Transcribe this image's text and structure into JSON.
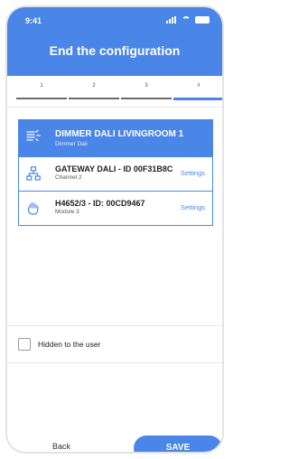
{
  "status_bar": {
    "time": "9:41"
  },
  "header": {
    "title": "End the configuration"
  },
  "steps": [
    {
      "label": "1",
      "active": false
    },
    {
      "label": "2",
      "active": false
    },
    {
      "label": "3",
      "active": false
    },
    {
      "label": "4",
      "active": true
    }
  ],
  "devices": [
    {
      "title": "DIMMER DALI LIVINGROOM 1",
      "subtitle": "Dimmer Dali",
      "icon": "dimmer-icon"
    },
    {
      "title": "GATEWAY DALI - ID 00F31B8C",
      "subtitle": "Channel 2",
      "icon": "network-icon",
      "action": "Settings"
    },
    {
      "title": "H4652/3 - ID: 00CD9467",
      "subtitle": "Module 3",
      "icon": "hand-touch-icon",
      "action": "Settings"
    }
  ],
  "hidden_option": {
    "label": "Hidden to the user",
    "checked": false
  },
  "footer": {
    "back_label": "Back",
    "save_label": "SAVE"
  },
  "colors": {
    "accent": "#4a86e8",
    "text": "#222222",
    "muted": "#555555"
  }
}
